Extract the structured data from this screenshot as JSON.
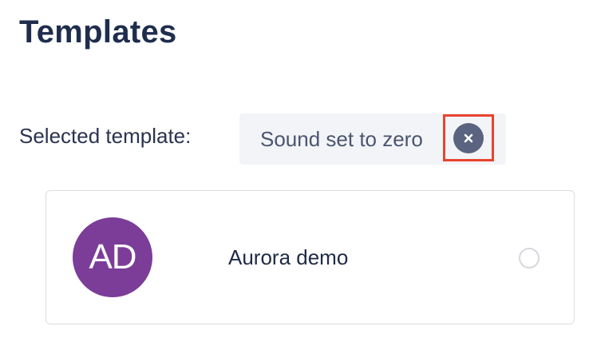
{
  "page": {
    "title": "Templates"
  },
  "selection": {
    "label": "Selected template:",
    "chip_label": "Sound set to zero",
    "remove_icon": "close-icon"
  },
  "templates": [
    {
      "initials": "AD",
      "name": "Aurora demo",
      "selected": false,
      "avatar_color": "#7b3d97"
    }
  ],
  "colors": {
    "heading": "#1f2d4d",
    "highlight_border": "#e8432f",
    "chip_background": "#f3f4f7"
  }
}
